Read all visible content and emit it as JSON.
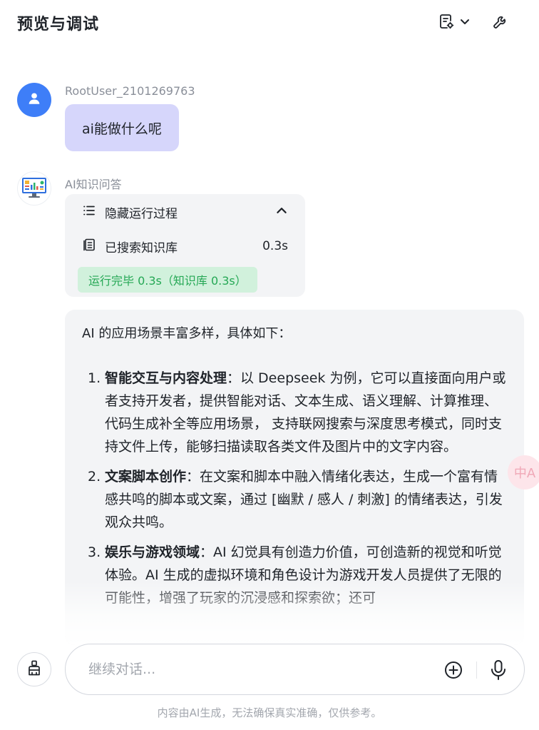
{
  "header": {
    "title": "预览与调试",
    "doc_settings_icon": "document-gear-icon",
    "dropdown_icon": "chevron-down-icon",
    "debug_icon": "wrench-icon"
  },
  "user_message": {
    "avatar_icon": "user-avatar-icon",
    "name": "RootUser_2101269763",
    "text": "ai能做什么呢",
    "bubble_color": "#d6d6fb"
  },
  "ai_message": {
    "avatar_icon": "monitor-chart-avatar-icon",
    "name": "AI知识问答",
    "process": {
      "toggle_icon": "list-icon",
      "toggle_label": "隐藏运行过程",
      "collapse_icon": "chevron-up-icon",
      "step_icon": "book-icon",
      "step_label": "已搜索知识库",
      "step_time": "0.3s",
      "status": "运行完毕 0.3s（知识库 0.3s）",
      "status_color": "#25a855"
    },
    "answer": {
      "intro": "AI 的应用场景丰富多样，具体如下：",
      "items": [
        {
          "num": "1.",
          "title": "智能交互与内容处理",
          "text": "：以 Deepseek 为例，它可以直接面向用户或者支持开发者，提供智能对话、文本生成、语义理解、计算推理、代码生成补全等应用场景， 支持联网搜索与深度思考模式，同时支持文件上传，能够扫描读取各类文件及图片中的文字内容。"
        },
        {
          "num": "2.",
          "title": "文案脚本创作",
          "text": "：在文案和脚本中融入情绪化表达，生成一个富有情感共鸣的脚本或文案，通过 [幽默 / 感人 / 刺激] 的情绪表达，引发观众共鸣。"
        },
        {
          "num": "3.",
          "title": "娱乐与游戏领域",
          "text": "：AI 幻觉具有创造力价值，可创造新的视觉和听觉体验。AI 生成的虚拟环境和角色设计为游戏开发人员提供了无限的可能性，增强了玩家的沉浸感和探索欲；还可"
        }
      ]
    }
  },
  "translate_float": {
    "icon": "translate-icon",
    "label": "中A"
  },
  "composer": {
    "clear_icon": "broom-icon",
    "placeholder": "继续对话...",
    "add_icon": "plus-circle-icon",
    "mic_icon": "microphone-icon"
  },
  "disclaimer": "内容由AI生成，无法确保真实准确，仅供参考。",
  "colors": {
    "accent": "#3e7ef8",
    "card_bg": "#f3f4f6"
  }
}
